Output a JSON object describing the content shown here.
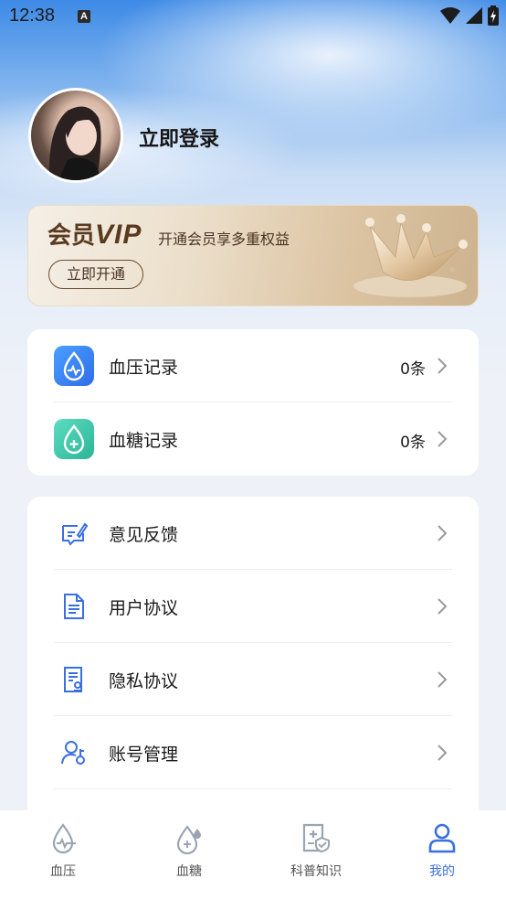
{
  "status_bar": {
    "time": "12:38",
    "badge": "A"
  },
  "profile": {
    "login_text": "立即登录"
  },
  "vip": {
    "title_prefix": "会员",
    "title_vip": "VIP",
    "subtitle": "开通会员享多重权益",
    "button": "立即开通"
  },
  "records": [
    {
      "label": "血压记录",
      "count": "0条",
      "icon": "blood-pressure-drop-icon",
      "color": "#3f7df0"
    },
    {
      "label": "血糖记录",
      "count": "0条",
      "icon": "blood-sugar-drop-icon",
      "color": "#3cc7a7"
    }
  ],
  "menu": [
    {
      "label": "意见反馈",
      "icon": "feedback-icon"
    },
    {
      "label": "用户协议",
      "icon": "document-icon"
    },
    {
      "label": "隐私协议",
      "icon": "privacy-document-icon"
    },
    {
      "label": "账号管理",
      "icon": "account-settings-icon"
    }
  ],
  "tabs": [
    {
      "label": "血压",
      "icon": "blood-pressure-tab-icon"
    },
    {
      "label": "血糖",
      "icon": "blood-sugar-tab-icon"
    },
    {
      "label": "科普知识",
      "icon": "knowledge-tab-icon"
    },
    {
      "label": "我的",
      "icon": "profile-tab-icon",
      "active": true
    }
  ],
  "colors": {
    "accent": "#3b6fe0",
    "text": "#1a1a1a",
    "vip_text": "#5a3a1f"
  }
}
